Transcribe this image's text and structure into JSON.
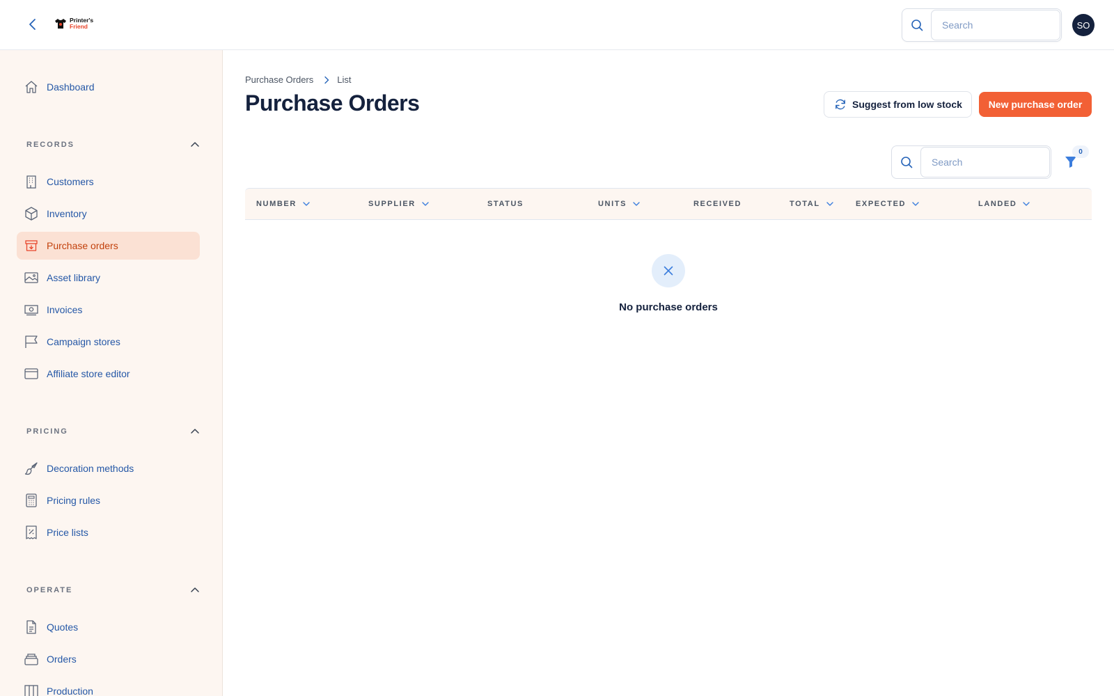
{
  "brand": {
    "line1": "Printer's",
    "line2": "Friend"
  },
  "topbar": {
    "search_placeholder": "Search",
    "avatar_initials": "SO"
  },
  "sidebar": {
    "dashboard": "Dashboard",
    "records": {
      "label": "RECORDS",
      "items": [
        "Customers",
        "Inventory",
        "Purchase orders",
        "Asset library",
        "Invoices",
        "Campaign stores",
        "Affiliate store editor"
      ]
    },
    "pricing": {
      "label": "PRICING",
      "items": [
        "Decoration methods",
        "Pricing rules",
        "Price lists"
      ]
    },
    "operate": {
      "label": "OPERATE",
      "items": [
        "Quotes",
        "Orders",
        "Production"
      ]
    },
    "active_item": "Purchase orders"
  },
  "breadcrumb": {
    "root": "Purchase Orders",
    "current": "List"
  },
  "page": {
    "title": "Purchase Orders",
    "suggest_label": "Suggest from low stock",
    "new_label": "New purchase order"
  },
  "table": {
    "search_placeholder": "Search",
    "filter_count": "0",
    "columns": [
      "NUMBER",
      "SUPPLIER",
      "STATUS",
      "UNITS",
      "RECEIVED",
      "TOTAL",
      "EXPECTED",
      "LANDED"
    ],
    "empty_message": "No purchase orders"
  },
  "colors": {
    "accent": "#f26035",
    "nav_text": "#2457a6",
    "sidebar_bg": "#fdf6f1",
    "active_bg": "#fbe1d4",
    "title": "#14213d"
  },
  "icons": {
    "back": "chevron-left-icon",
    "search": "search-icon",
    "dashboard": "home-icon",
    "customers": "building-icon",
    "inventory": "box-icon",
    "purchase_orders": "archive-down-icon",
    "asset_library": "image-icon",
    "invoices": "banknote-icon",
    "campaign_stores": "flag-icon",
    "affiliate_store_editor": "browser-window-icon",
    "decoration_methods": "brush-icon",
    "pricing_rules": "calculator-icon",
    "price_lists": "receipt-percent-icon",
    "quotes": "document-icon",
    "orders": "tray-stack-icon",
    "production": "columns-icon",
    "filter": "funnel-icon",
    "suggest": "refresh-icon",
    "empty": "x-icon"
  }
}
